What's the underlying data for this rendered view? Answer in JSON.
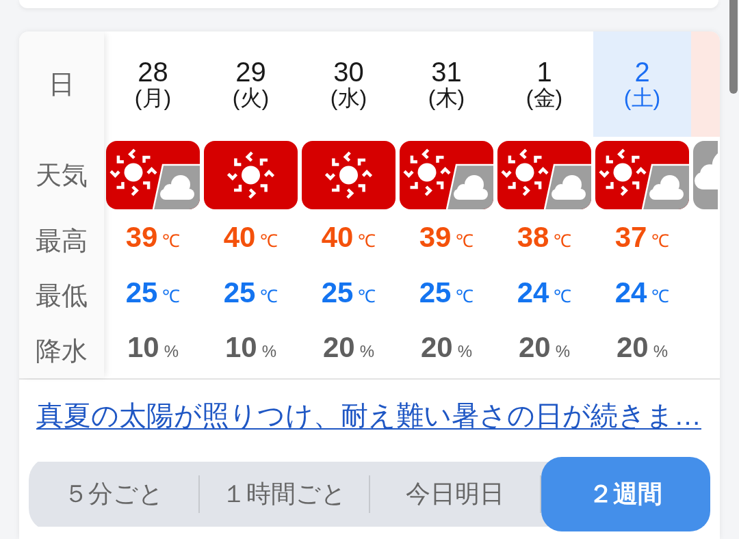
{
  "forecast": {
    "row_labels": [
      "日",
      "天気",
      "最高",
      "最低",
      "降水"
    ],
    "days": [
      {
        "date": "28",
        "weekday": "(月)",
        "kind": "weekday",
        "weather": {
          "kind": "sunny-then-cloudy"
        },
        "high": {
          "value": "39",
          "unit": "℃"
        },
        "low": {
          "value": "25",
          "unit": "℃"
        },
        "precip": {
          "value": "10",
          "unit": "%"
        }
      },
      {
        "date": "29",
        "weekday": "(火)",
        "kind": "weekday",
        "weather": {
          "kind": "sunny"
        },
        "high": {
          "value": "40",
          "unit": "℃"
        },
        "low": {
          "value": "25",
          "unit": "℃"
        },
        "precip": {
          "value": "10",
          "unit": "%"
        }
      },
      {
        "date": "30",
        "weekday": "(水)",
        "kind": "weekday",
        "weather": {
          "kind": "sunny"
        },
        "high": {
          "value": "40",
          "unit": "℃"
        },
        "low": {
          "value": "25",
          "unit": "℃"
        },
        "precip": {
          "value": "20",
          "unit": "%"
        }
      },
      {
        "date": "31",
        "weekday": "(木)",
        "kind": "weekday",
        "weather": {
          "kind": "sunny-then-cloudy"
        },
        "high": {
          "value": "39",
          "unit": "℃"
        },
        "low": {
          "value": "25",
          "unit": "℃"
        },
        "precip": {
          "value": "20",
          "unit": "%"
        }
      },
      {
        "date": "1",
        "weekday": "(金)",
        "kind": "weekday",
        "weather": {
          "kind": "sunny-then-cloudy"
        },
        "high": {
          "value": "38",
          "unit": "℃"
        },
        "low": {
          "value": "24",
          "unit": "℃"
        },
        "precip": {
          "value": "20",
          "unit": "%"
        }
      },
      {
        "date": "2",
        "weekday": "(土)",
        "kind": "saturday",
        "weather": {
          "kind": "sunny-then-cloudy"
        },
        "high": {
          "value": "37",
          "unit": "℃"
        },
        "low": {
          "value": "24",
          "unit": "℃"
        },
        "precip": {
          "value": "20",
          "unit": "%"
        }
      },
      {
        "kind": "sunday",
        "weather": {
          "kind": "cloudy"
        }
      }
    ]
  },
  "summary_link": "真夏の太陽が照りつけ、耐え難い暑さの日が続きま…",
  "range_tabs": [
    {
      "label": "５分ごと",
      "selected": false
    },
    {
      "label": "１時間ごと",
      "selected": false
    },
    {
      "label": "今日明日",
      "selected": false
    },
    {
      "label": "２週間",
      "selected": true
    }
  ]
}
